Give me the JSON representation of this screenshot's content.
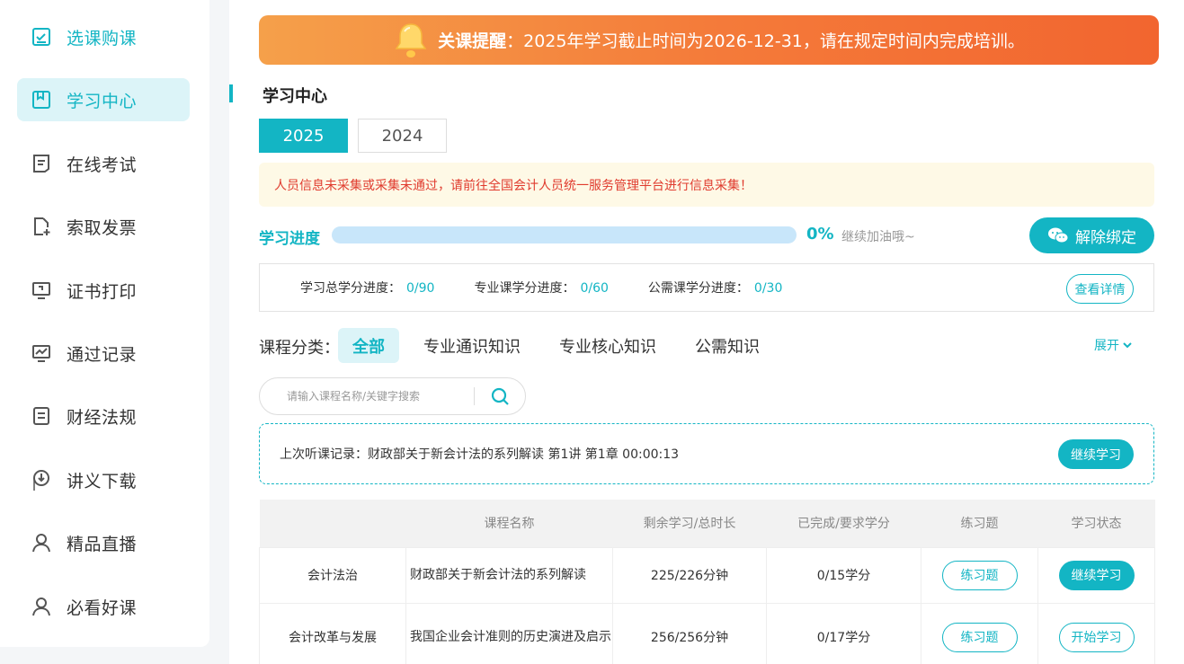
{
  "sidebar": {
    "items": [
      {
        "label": "选课购课",
        "icon": "checklist-icon"
      },
      {
        "label": "学习中心",
        "icon": "book-icon"
      },
      {
        "label": "在线考试",
        "icon": "exam-icon"
      },
      {
        "label": "索取发票",
        "icon": "invoice-icon"
      },
      {
        "label": "证书打印",
        "icon": "certificate-icon"
      },
      {
        "label": "通过记录",
        "icon": "chart-icon"
      },
      {
        "label": "财经法规",
        "icon": "document-icon"
      },
      {
        "label": "讲义下载",
        "icon": "download-icon"
      },
      {
        "label": "精品直播",
        "icon": "user-icon"
      },
      {
        "label": "必看好课",
        "icon": "user-icon"
      }
    ],
    "active_index": 1
  },
  "notice": {
    "strong": "关课提醒",
    "text": "：2025年学习截止时间为2026-12-31，请在规定时间内完成培训。"
  },
  "section_title": "学习中心",
  "years": [
    "2025",
    "2024"
  ],
  "warning": "人员信息未采集或采集未通过，请前往全国会计人员统一服务管理平台进行信息采集！",
  "progress": {
    "label": "学习进度",
    "percent_text": "0%",
    "percent": 0,
    "tip": "继续加油哦~"
  },
  "unbind_label": "解除绑定",
  "credits": [
    {
      "label": "学习总学分进度：",
      "value": "0/90"
    },
    {
      "label": "专业课学分进度：",
      "value": "0/60"
    },
    {
      "label": "公需课学分进度：",
      "value": "0/30"
    }
  ],
  "detail_label": "查看详情",
  "categories": {
    "label": "课程分类：",
    "items": [
      "全部",
      "专业通识知识",
      "专业核心知识",
      "公需知识"
    ],
    "expand": "展开"
  },
  "search": {
    "placeholder": "请输入课程名称/关键字搜索"
  },
  "last_record": {
    "text": "上次听课记录：财政部关于新会计法的系列解读 第1讲 第1章 00:00:13",
    "button": "继续学习"
  },
  "table": {
    "headers": [
      "",
      "课程名称",
      "剩余学习/总时长",
      "已完成/要求学分",
      "练习题",
      "学习状态"
    ],
    "rows": [
      {
        "category": "会计法治",
        "name": "财政部关于新会计法的系列解读",
        "duration": "225/226分钟",
        "credit": "0/15学分",
        "exercise": "练习题",
        "status": "继续学习"
      },
      {
        "category": "会计改革与发展",
        "name": "我国企业会计准则的历史演进及启示",
        "duration": "256/256分钟",
        "credit": "0/17学分",
        "exercise": "练习题",
        "status": "开始学习"
      }
    ]
  },
  "colors": {
    "accent": "#13b5c4",
    "warning": "#e03b2e",
    "notice_start": "#f5a04a",
    "notice_end": "#f2652f"
  }
}
